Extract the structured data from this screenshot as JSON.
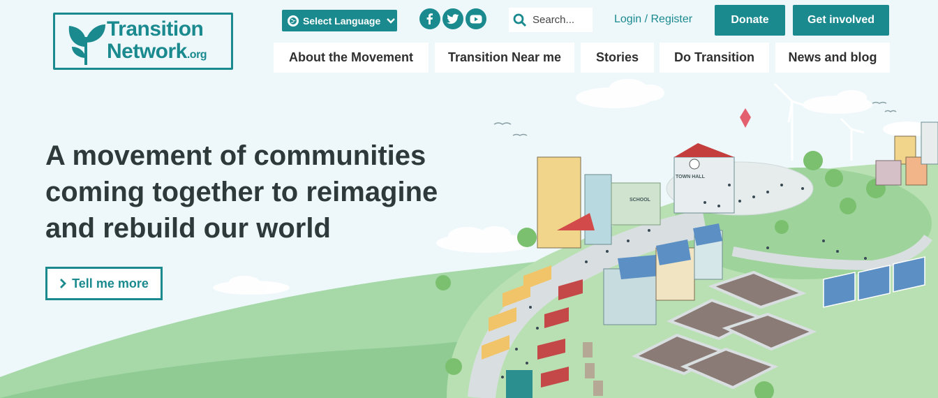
{
  "logo": {
    "line1": "Transition",
    "line2": "Network",
    "suffix": ".org"
  },
  "header": {
    "language": "Select Language",
    "search_placeholder": "Search...",
    "login": "Login / Register",
    "donate": "Donate",
    "get_involved": "Get involved",
    "social": [
      "facebook-icon",
      "twitter-icon",
      "youtube-icon"
    ]
  },
  "nav": {
    "items": [
      {
        "label": "About the Movement"
      },
      {
        "label": "Transition Near me"
      },
      {
        "label": "Stories"
      },
      {
        "label": "Do Transition"
      },
      {
        "label": "News and blog"
      }
    ]
  },
  "hero": {
    "headline": [
      "A movement of communities",
      "coming together to reimagine",
      "and rebuild our world"
    ],
    "cta": "Tell me more",
    "town_hall": "TOWN HALL",
    "school": "SCHOOL"
  },
  "colors": {
    "accent": "#1a8a8f",
    "background": "#eef8fb",
    "text": "#2e3a3a"
  }
}
